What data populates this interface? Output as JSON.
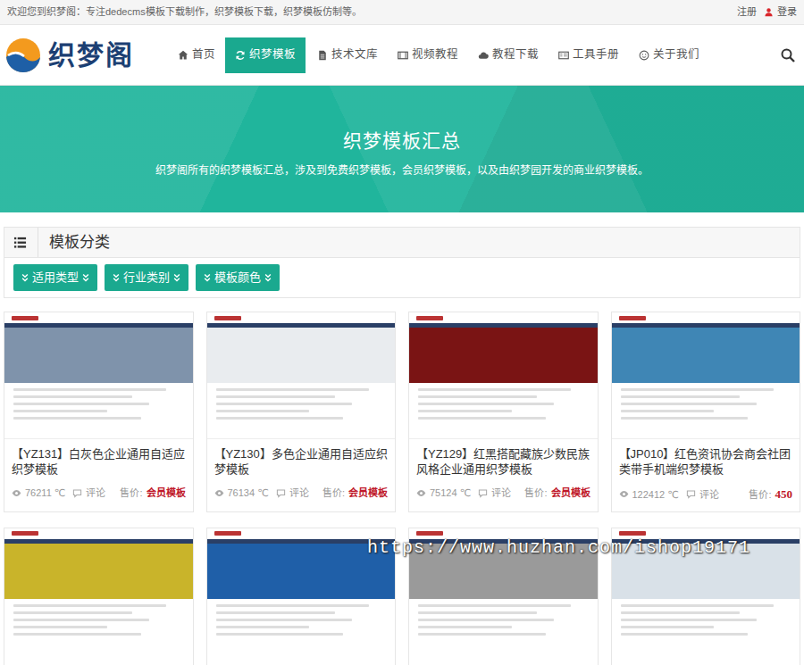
{
  "topbar": {
    "welcome": "欢迎您到织梦阁：专注dedecms模板下载制作，织梦模板下载，织梦模板仿制等。",
    "register": "注册",
    "login": "登录"
  },
  "logo": {
    "name": "织梦阁"
  },
  "nav": [
    {
      "label": "首页",
      "selected": false
    },
    {
      "label": "织梦模板",
      "selected": true
    },
    {
      "label": "技术文库",
      "selected": false
    },
    {
      "label": "视频教程",
      "selected": false
    },
    {
      "label": "教程下载",
      "selected": false
    },
    {
      "label": "工具手册",
      "selected": false
    },
    {
      "label": "关于我们",
      "selected": false
    }
  ],
  "banner": {
    "title": "织梦模板汇总",
    "subtitle": "织梦阁所有的织梦模板汇总，涉及到免费织梦模板，会员织梦模板，以及由织梦园开发的商业织梦模板。"
  },
  "category": {
    "title": "模板分类",
    "filters": [
      "适用类型",
      "行业类别",
      "模板颜色"
    ]
  },
  "templates": [
    {
      "title": "【YZ131】白灰色企业通用自适应织梦模板",
      "views": "76211 ℃",
      "comment": "评论",
      "price_label": "售价:",
      "price": "会员模板",
      "kind": "member",
      "color": "#7f93ab"
    },
    {
      "title": "【YZ130】多色企业通用自适应织梦模板",
      "views": "76134 ℃",
      "comment": "评论",
      "price_label": "售价:",
      "price": "会员模板",
      "kind": "member",
      "color": "#e9ecef"
    },
    {
      "title": "【YZ129】红黑搭配藏族少数民族风格企业通用织梦模板",
      "views": "75124 ℃",
      "comment": "评论",
      "price_label": "售价:",
      "price": "会员模板",
      "kind": "member",
      "color": "#7a1414"
    },
    {
      "title": "【JP010】红色资讯协会商会社团类带手机端织梦模板",
      "views": "122412 ℃",
      "comment": "评论",
      "price_label": "售价:",
      "price": "450",
      "kind": "paid",
      "color": "#3f86b5"
    }
  ],
  "more_templates": [
    {
      "color": "#c9b42a"
    },
    {
      "color": "#1f5fa8"
    },
    {
      "color": "#9a9a9a"
    },
    {
      "color": "#d9e1e8"
    }
  ],
  "watermark": "https://www.huzhan.com/ishop19171"
}
